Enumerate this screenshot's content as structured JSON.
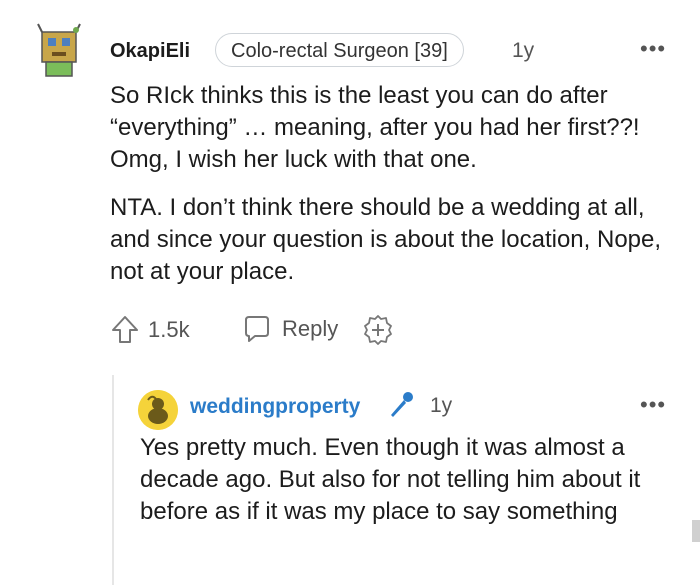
{
  "comment": {
    "username": "OkapiEli",
    "flair": "Colo-rectal Surgeon [39]",
    "age": "1y",
    "more": "•••",
    "paragraphs": [
      "So RIck thinks this is the least you can do after “everything” … meaning, after you had her first??! Omg, I wish her luck with that one.",
      "NTA. I don’t think there should be a wedding at all, and since your question is about the location, Nope, not at your place."
    ],
    "upvotes": "1.5k",
    "reply_label": "Reply"
  },
  "reply": {
    "username": "weddingproperty",
    "age": "1y",
    "more": "•••",
    "text": "Yes pretty much. Even though it was almost a decade ago. But also for not telling him about it before as if it was my place to say something"
  },
  "colors": {
    "reply_username": "#2b7cc9",
    "mod_icon": "#2b7cc9",
    "avatar_bg": "#f5d33a"
  },
  "icons": [
    "upvote-icon",
    "reply-icon",
    "award-icon",
    "microphone-icon",
    "more-icon"
  ]
}
